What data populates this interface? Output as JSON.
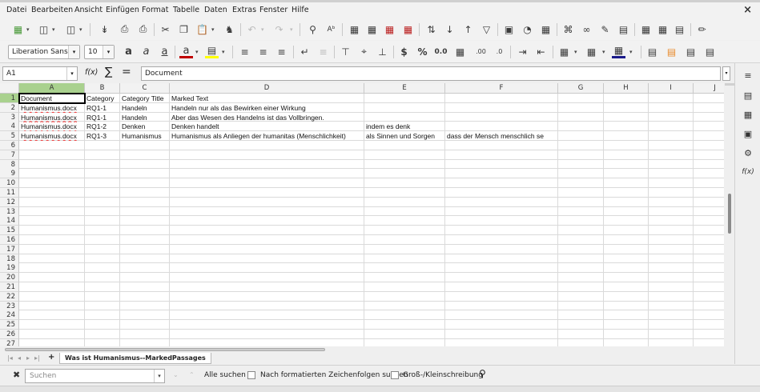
{
  "menubar": {
    "items": [
      "Datei",
      "Bearbeiten",
      "Ansicht",
      "Einfügen",
      "Format",
      "Tabelle",
      "Daten",
      "Extras",
      "Fenster",
      "Hilfe"
    ],
    "close_glyph": "×"
  },
  "toolbar2": {
    "font_name": "Liberation Sans",
    "font_size": "10"
  },
  "formula": {
    "cell_ref": "A1",
    "fx_label": "f(x)",
    "sum_glyph": "∑",
    "eq_glyph": "=",
    "value": "Document"
  },
  "sheet": {
    "columns": [
      "A",
      "B",
      "C",
      "D",
      "E",
      "F",
      "G",
      "H",
      "I",
      "J"
    ],
    "rows": [
      "1",
      "2",
      "3",
      "4",
      "5",
      "6",
      "7",
      "8",
      "9",
      "10",
      "11",
      "12",
      "13",
      "14",
      "15",
      "16",
      "17",
      "18",
      "19",
      "20",
      "21",
      "22",
      "23",
      "24",
      "25",
      "26",
      "27"
    ],
    "cells": [
      [
        "Document",
        "Category",
        "Category Title",
        "Marked Text",
        "",
        ""
      ],
      [
        "Humanismus.docx",
        "RQ1-1",
        "Handeln",
        "Handeln nur als das Bewirken einer Wirkung",
        "",
        ""
      ],
      [
        "Humanismus.docx",
        "RQ1-1",
        "Handeln",
        "Aber das Wesen des Handelns ist das Vollbringen.",
        "",
        ""
      ],
      [
        "Humanismus.docx",
        "RQ1-2",
        "Denken",
        " Denken handelt",
        "indem es denk",
        ""
      ],
      [
        "Humanismus.docx",
        "RQ1-3",
        "Humanismus",
        " Humanismus als Anliegen der humanitas (Menschlichkeit)",
        "als Sinnen und Sorgen",
        "dass der Mensch menschlich se"
      ]
    ]
  },
  "tabs": {
    "add_glyph": "+",
    "active_tab": "Was ist Humanismus--MarkedPassages"
  },
  "findbar": {
    "placeholder": "Suchen",
    "find_all": "Alle suchen",
    "formatted": "Nach formatierten Zeichenfolgen suchen",
    "match_case": "Groß-/Kleinschreibung"
  },
  "colors": {
    "header_active": "#a9d18e",
    "spell_underline": "#e33333"
  }
}
